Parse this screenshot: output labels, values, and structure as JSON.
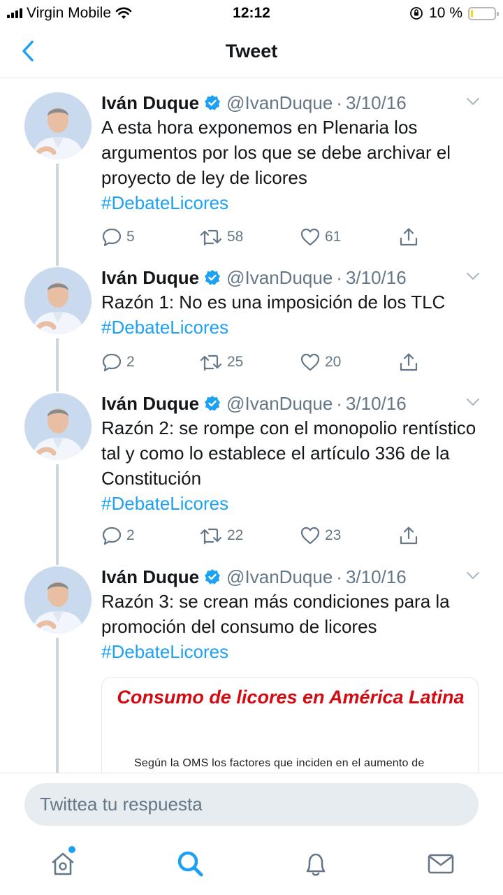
{
  "status_bar": {
    "carrier": "Virgin Mobile",
    "time": "12:12",
    "battery_percent": "10 %",
    "battery_level": 0.1
  },
  "nav": {
    "title": "Tweet",
    "back_icon": "chevron-left-icon"
  },
  "tweets": [
    {
      "author": "Iván Duque",
      "handle": "@IvanDuque",
      "separator": "·",
      "date": "3/10/16",
      "text": "A esta hora exponemos en Plenaria los argumentos por los que se debe archivar el proyecto de ley de licores",
      "hashtag": "#DebateLicores",
      "replies": "5",
      "retweets": "58",
      "likes": "61"
    },
    {
      "author": "Iván Duque",
      "handle": "@IvanDuque",
      "separator": "·",
      "date": "3/10/16",
      "text": "Razón 1: No es una imposición de los TLC",
      "hashtag": "#DebateLicores",
      "replies": "2",
      "retweets": "25",
      "likes": "20"
    },
    {
      "author": "Iván Duque",
      "handle": "@IvanDuque",
      "separator": "·",
      "date": "3/10/16",
      "text": "Razón 2: se rompe con el monopolio rentístico tal y como lo establece el artículo 336 de la Constitución",
      "hashtag": "#DebateLicores",
      "replies": "2",
      "retweets": "22",
      "likes": "23"
    },
    {
      "author": "Iván Duque",
      "handle": "@IvanDuque",
      "separator": "·",
      "date": "3/10/16",
      "text": "Razón 3: se crean más condiciones para la promoción del consumo de licores",
      "hashtag": "#DebateLicores",
      "media": {
        "title": "Consumo de licores en América Latina",
        "body": "Según la OMS los factores que inciden en el aumento de"
      }
    }
  ],
  "reply": {
    "placeholder": "Twittea tu respuesta"
  },
  "tabs": [
    {
      "name": "home",
      "icon": "home-icon"
    },
    {
      "name": "search",
      "icon": "search-icon"
    },
    {
      "name": "notifications",
      "icon": "bell-icon"
    },
    {
      "name": "messages",
      "icon": "mail-icon"
    }
  ],
  "colors": {
    "accent": "#1da1f2",
    "text": "#14171a",
    "secondary": "#657786",
    "border": "#e1e8ed",
    "media_title": "#d20a11"
  }
}
